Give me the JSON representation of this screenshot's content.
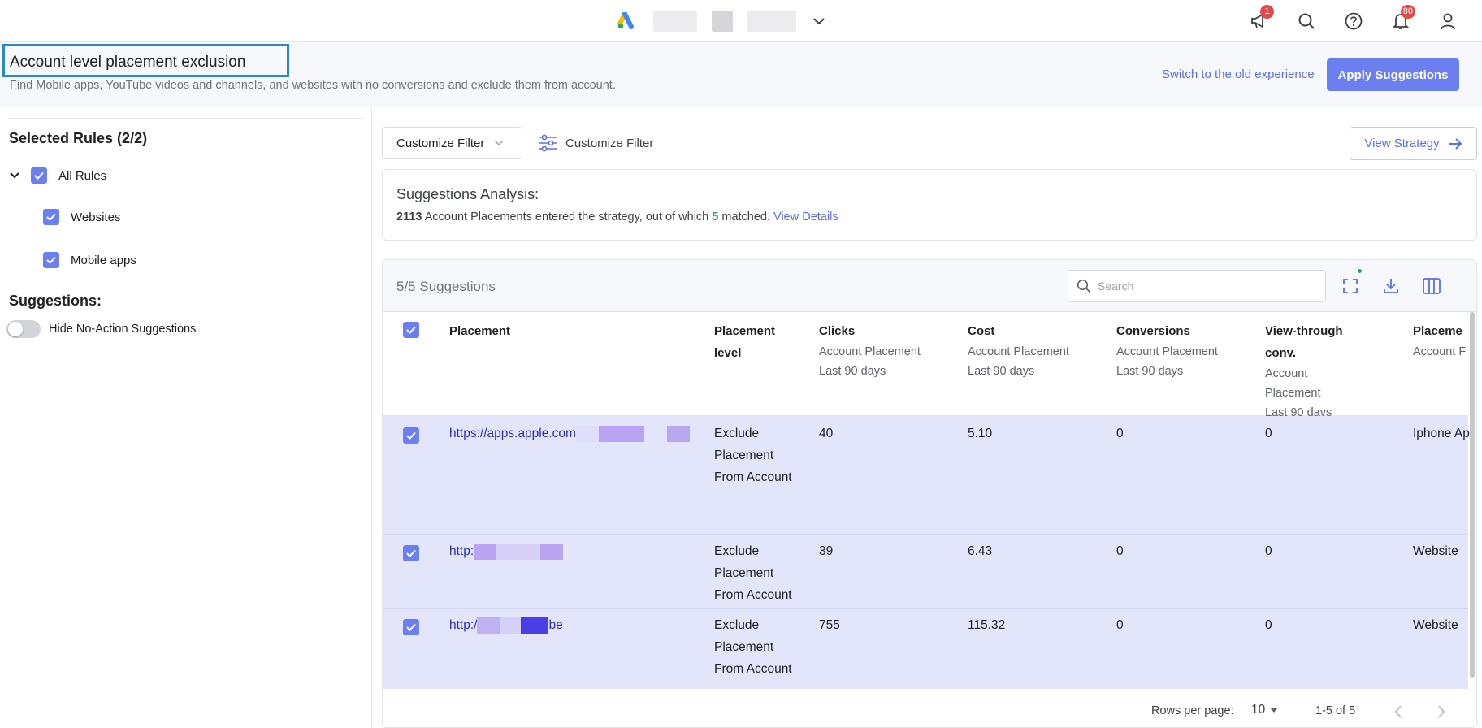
{
  "topbar": {
    "notifications_badge": "1",
    "alerts_badge": "80"
  },
  "header": {
    "title": "Account level placement exclusion",
    "subtitle": "Find Mobile apps, YouTube videos and channels, and websites with no conversions and exclude them from account.",
    "switch_link": "Switch to the old experience",
    "apply_button": "Apply Suggestions"
  },
  "left_panel": {
    "selected_rules_title": "Selected Rules (2/2)",
    "rules": [
      {
        "label": "All Rules",
        "checked": true
      },
      {
        "label": "Websites",
        "checked": true
      },
      {
        "label": "Mobile apps",
        "checked": true
      }
    ],
    "suggestions_title": "Suggestions:",
    "hide_toggle_label": "Hide No-Action Suggestions",
    "hide_toggle_on": false
  },
  "toolbar": {
    "filter_dropdown": "Customize Filter",
    "filter_button": "Customize Filter",
    "view_strategy": "View Strategy"
  },
  "analysis": {
    "title": "Suggestions Analysis:",
    "entered_count": "2113",
    "text_a": " Account Placements entered the strategy, out of which ",
    "matched_count": "5",
    "text_b": " matched. ",
    "link": "View Details"
  },
  "table": {
    "count_label": "5/5 Suggestions",
    "search_placeholder": "Search",
    "columns": [
      {
        "header": "Placement",
        "sub1": "",
        "sub2": ""
      },
      {
        "header": "Placement level",
        "sub1": "",
        "sub2": ""
      },
      {
        "header": "Clicks",
        "sub1": "Account Placement",
        "sub2": "Last 90 days"
      },
      {
        "header": "Cost",
        "sub1": "Account Placement",
        "sub2": "Last 90 days"
      },
      {
        "header": "Conversions",
        "sub1": "Account Placement",
        "sub2": "Last 90 days"
      },
      {
        "header": "View-through conv.",
        "sub1": "Account Placement",
        "sub2": "Last 90 days"
      },
      {
        "header": "Placeme",
        "sub1": "Account F",
        "sub2": ""
      }
    ],
    "rows": [
      {
        "placement": "https://apps.apple.com",
        "level": "Exclude Placement From Account",
        "clicks": "40",
        "cost": "5.10",
        "conversions": "0",
        "view_through": "0",
        "type": "Iphone Ap"
      },
      {
        "placement": "http:",
        "level": "Exclude Placement From Account",
        "clicks": "39",
        "cost": "6.43",
        "conversions": "0",
        "view_through": "0",
        "type": "Website"
      },
      {
        "placement": "http:/",
        "placement_suffix": "be",
        "level": "Exclude Placement From Account",
        "clicks": "755",
        "cost": "115.32",
        "conversions": "0",
        "view_through": "0",
        "type": "Website"
      }
    ],
    "footer": {
      "rows_per_page_label": "Rows per page:",
      "rows_per_page_value": "10",
      "range": "1-5 of 5"
    }
  },
  "colors": {
    "accent": "#6b7ff0",
    "link": "#5b6ee1",
    "row_selected": "#e3e6fb",
    "badge": "#e04a4a",
    "title_outline": "#2a8ac9"
  }
}
